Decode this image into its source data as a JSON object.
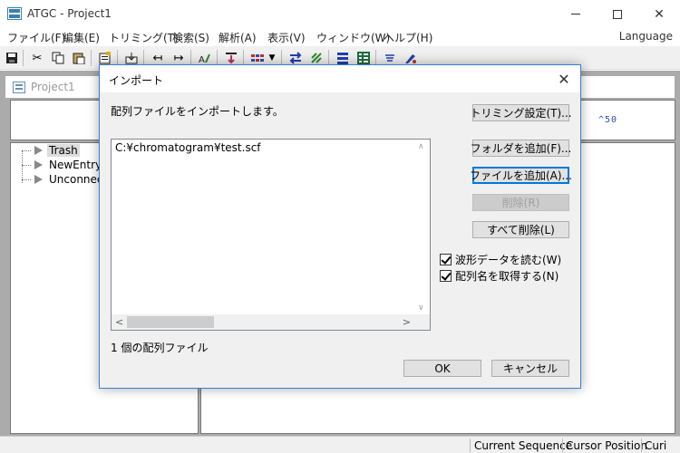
{
  "window": {
    "title": "ATGC - Project1"
  },
  "menu": {
    "items": [
      "ファイル(F)",
      "編集(E)",
      "トリミング(T)",
      "検索(S)",
      "解析(A)",
      "表示(V)",
      "ウィンドウ(W)",
      "ヘルプ(H)"
    ],
    "language": "Language"
  },
  "toolbar": {
    "icons": [
      "save-icon",
      "cut-icon",
      "copy-icon",
      "paste-icon",
      "properties-icon",
      "import-icon",
      "trim-left-icon",
      "trim-right-icon",
      "assemble-icon",
      "insert-icon",
      "color-palette-icon",
      "swap-icon",
      "align-icon",
      "list-icon",
      "table-icon",
      "menu-lines-icon",
      "edit-icon"
    ]
  },
  "project": {
    "title": "Project1",
    "ruler_text": "^50",
    "tree": [
      "Trash",
      "NewEntry",
      "Unconnect"
    ]
  },
  "dialog": {
    "title": "インポート",
    "description": "配列ファイルをインポートします。",
    "files": [
      "C:¥chromatogram¥test.scf"
    ],
    "count_text": "1 個の配列ファイル",
    "buttons": {
      "trim_settings": "トリミング設定(T)...",
      "add_folder": "フォルダを追加(F)...",
      "add_file": "ファイルを追加(A)...",
      "remove": "削除(R)",
      "remove_all": "すべて削除(L)",
      "ok": "OK",
      "cancel": "キャンセル"
    },
    "checkboxes": {
      "read_waveform": "波形データを読む(W)",
      "get_seq_name": "配列名を取得する(N)"
    }
  },
  "statusbar": {
    "cells": [
      "Current Sequence",
      "Cursor Position",
      "Curi"
    ]
  }
}
